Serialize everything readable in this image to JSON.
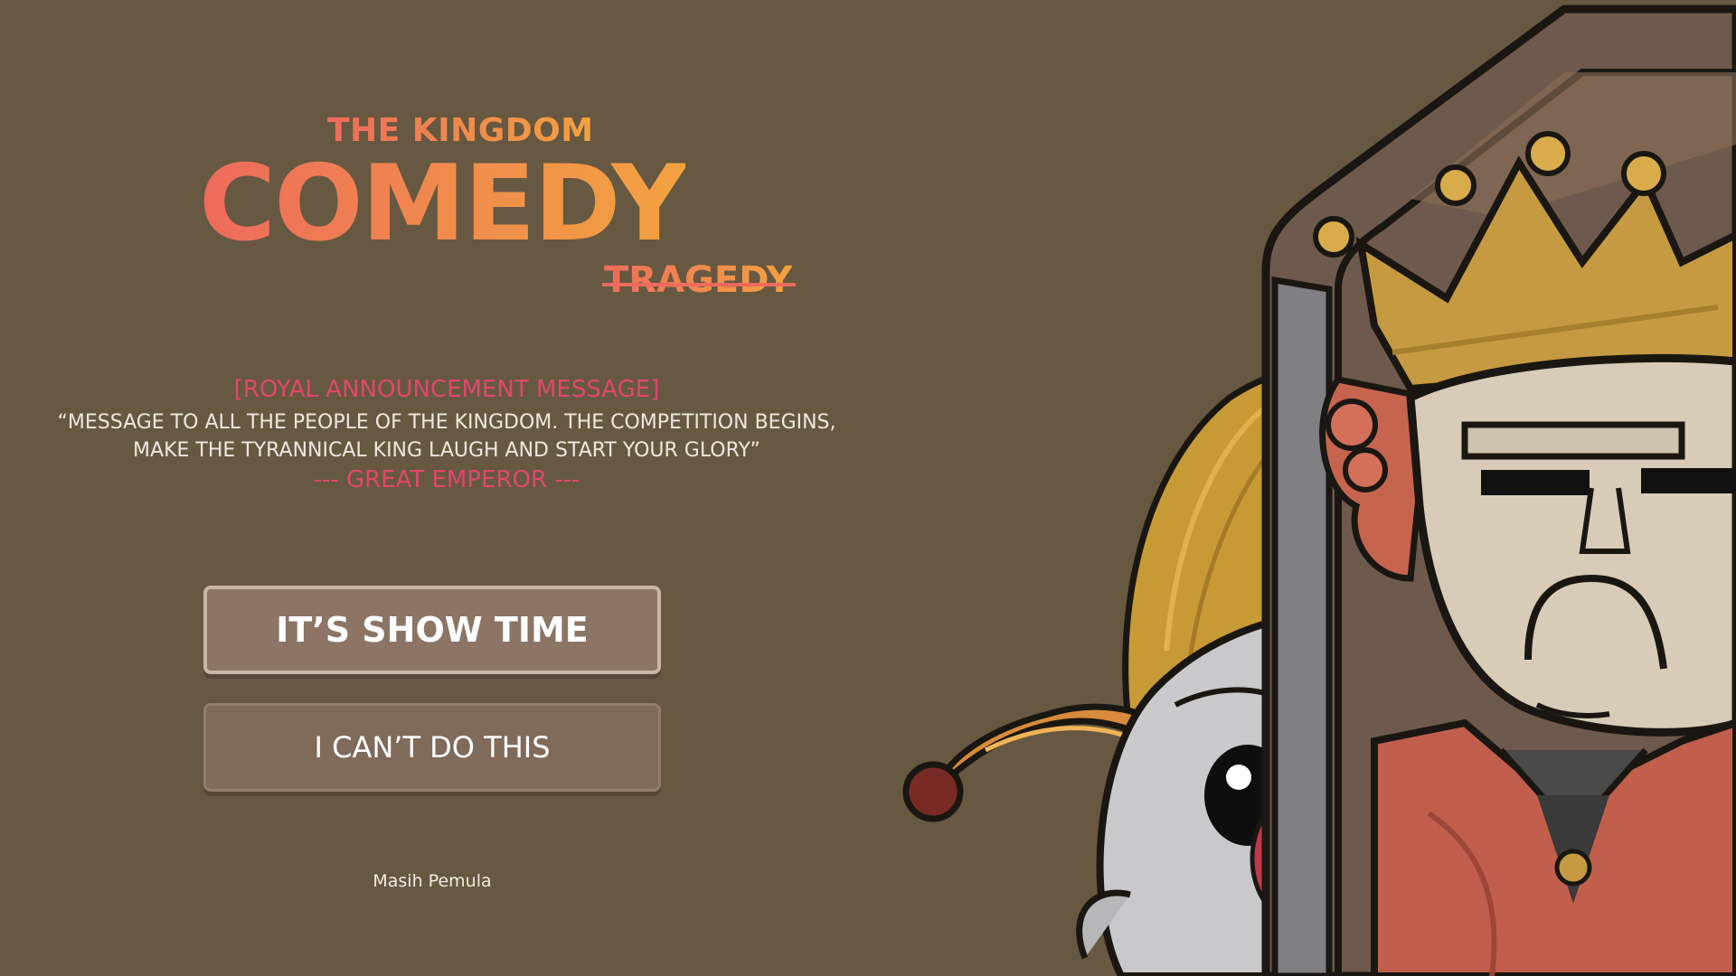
{
  "title": {
    "subtitle": "THE KINGDOM",
    "main": "COMEDY",
    "struck": "TRAGEDY"
  },
  "announcement": {
    "heading": "[ROYAL ANNOUNCEMENT MESSAGE]",
    "line1": "“MESSAGE TO ALL THE PEOPLE OF THE KINGDOM. THE COMPETITION BEGINS,",
    "line2": "MAKE THE TYRANNICAL KING LAUGH AND START YOUR GLORY”",
    "signature": "--- GREAT EMPEROR ---"
  },
  "buttons": {
    "start_label": "IT’S SHOW TIME",
    "quit_label": "I CAN’T DO THIS"
  },
  "footer": {
    "credit": "Masih Pemula"
  },
  "illustration": {
    "subjects": [
      "king-with-crown",
      "jester-peeking"
    ]
  },
  "colors": {
    "background": "#675842",
    "title_gradient_start": "#ee6a5c",
    "title_gradient_end": "#f3a23f",
    "accent_pink": "#e0476b",
    "button_primary": "#8c7565",
    "button_secondary": "#806b5b"
  }
}
